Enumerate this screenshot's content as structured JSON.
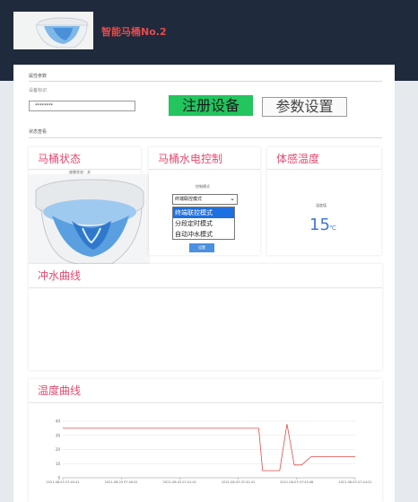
{
  "header": {
    "title": "智能马桶No.2"
  },
  "props": {
    "section_label": "属性参数",
    "device_id_label": "设备标识",
    "device_id_value": "********",
    "register_label": "注册设备",
    "params_label": "参数设置"
  },
  "status": {
    "section_label": "状态查看",
    "toilet_status": {
      "title": "马桶状态",
      "caption": "座圈状态：关"
    },
    "control": {
      "title": "马桶水电控制",
      "mode_label": "控制模式",
      "selected": "终端联控模式",
      "options": [
        "终端联控模式",
        "分段定时模式",
        "自动冲水模式"
      ],
      "set_label": "设置"
    },
    "temperature": {
      "title": "体感温度",
      "label": "温度值",
      "value": "15",
      "unit": "℃"
    }
  },
  "flush_curve": {
    "title": "冲水曲线"
  },
  "temp_curve": {
    "title": "温度曲线"
  },
  "colors": {
    "accent": "#e64a6e",
    "register_bg": "#22c55e",
    "link_blue": "#3b78d8",
    "line": "#e64a4a"
  },
  "chart_data": {
    "type": "line",
    "title": "",
    "xlabel": "",
    "ylabel": "",
    "ylim": [
      0,
      40
    ],
    "yticks": [
      0,
      10,
      20,
      30,
      40
    ],
    "x_tick_labels": [
      "2021-08-03 07:40:41",
      "2021-08-03 07:40:41",
      "2021-08-03 07:41:41",
      "2021-08-03 07:42:41",
      "2021-08-03 07:43:48",
      "2021-08-03 07:44:22"
    ],
    "series": [
      {
        "x": [
          0,
          1,
          2,
          3,
          4.02,
          4.1,
          4.45,
          4.6,
          4.75,
          4.9,
          5.1,
          6
        ],
        "values": [
          35,
          35,
          35,
          35,
          35,
          5,
          5,
          38,
          9,
          9,
          15,
          15
        ]
      }
    ],
    "grid": true
  }
}
